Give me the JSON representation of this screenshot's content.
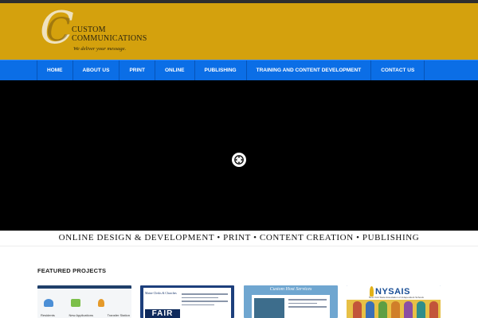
{
  "brand": {
    "name_line1": "CUSTOM",
    "name_line2": "COMMUNICATIONS",
    "tagline": "We deliver your message."
  },
  "nav": {
    "items": [
      "HOME",
      "ABOUT US",
      "PRINT",
      "ONLINE",
      "PUBLISHING",
      "TRAINING AND CONTENT DEVELOPMENT",
      "CONTACT US"
    ]
  },
  "hero": {
    "play_icon": "play-icon",
    "background": "#000000"
  },
  "services_tagline": "ONLINE DESIGN & DEVELOPMENT • PRINT • CONTENT CREATION • PUBLISHING",
  "featured": {
    "heading": "FEATURED PROJECTS",
    "projects": [
      {
        "labels": [
          "Residents",
          "New Applications",
          "Transfer Station"
        ]
      },
      {
        "header": "Maine Clerks & Churches",
        "badge": "FAIR"
      },
      {
        "title": "Custom Host Services"
      },
      {
        "logo": "NYSAIS",
        "subtitle": "New York State Association of Independent Schools"
      }
    ]
  },
  "colors": {
    "header_bg": "#d4a10d",
    "nav_bg": "#0b6ee6",
    "hero_bg": "#000000"
  }
}
